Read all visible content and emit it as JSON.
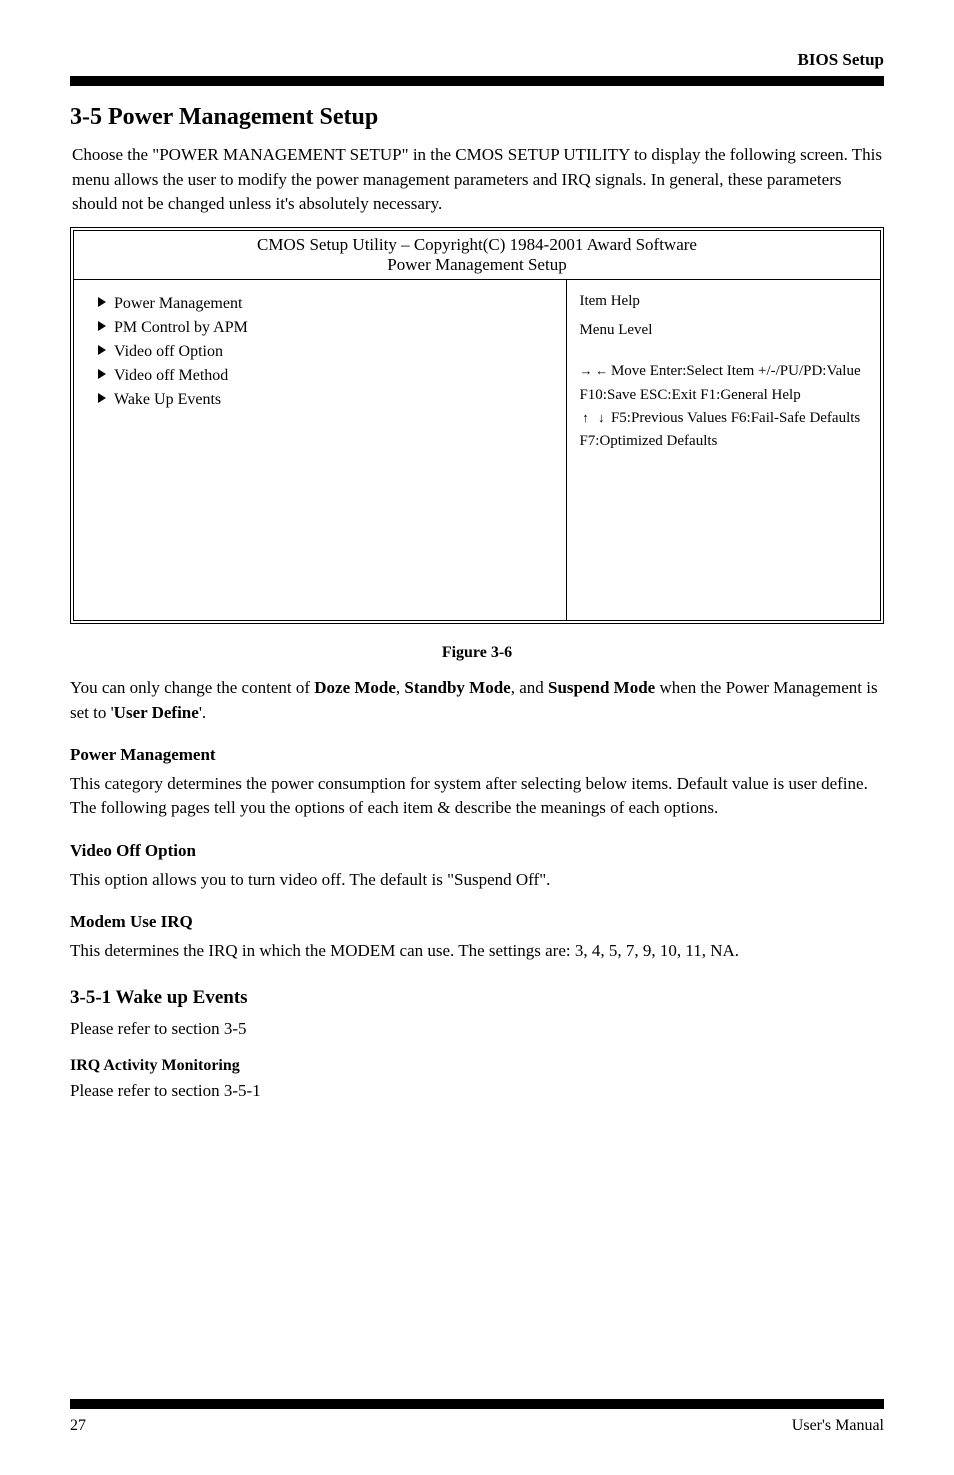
{
  "header": {
    "label": "BIOS Setup"
  },
  "section_title": "3-5  Power Management Setup",
  "intro": "Choose the \"POWER MANAGEMENT SETUP\" in the CMOS SETUP UTILITY to display the following screen. This menu allows the user to modify the power management parameters and IRQ signals.  In general, these parameters should not be changed unless it's absolutely necessary.",
  "bios": {
    "title": "CMOS Setup Utility – Copyright(C) 1984-2001 Award Software\nPower Management Setup",
    "menu": [
      "Power Management",
      "PM Control by APM",
      "Video off Option",
      "Video off Method",
      "Wake Up Events"
    ],
    "help": {
      "heading": "Item Help",
      "menu_level_label": "Menu Level",
      "menu_level_value": "",
      "lines": [
        "Move  Enter:Select  Item  +/-/PU/PD:Value  F10:Save ESC:Exit F1:General Help",
        "F5:Previous Values  F6:Fail-Safe Defaults  F7:Optimized Defaults"
      ]
    }
  },
  "figure_caption": "Figure 3-6",
  "body": {
    "p1": "You can only change the content of Doze Mode, Standby Mode, and Suspend Mode when the Power Management is set to 'User Define'.",
    "pm_heading": "Power Management",
    "pm_p1": "This category determines the power consumption for system after selecting below items. Default value is user define. The following pages tell you the options of each item & describe the meanings of each options.",
    "video_off_heading": "Video Off Option",
    "video_off_p": "This option allows you to turn video off. The default is \"Suspend Off\".",
    "mo_heading": "Modem Use IRQ",
    "mo_p": "This determines the IRQ in which the MODEM can use. The settings are: 3, 4, 5, 7, 9, 10, 11, NA.",
    "sub_title": "3-5-1  Wake up Events",
    "sub_p": "Please refer to section 3-5",
    "sub_sub": "IRQ Activity Monitoring",
    "sub_sub_p": "Please refer to section 3-5-1"
  },
  "footer": {
    "left": "27",
    "right": "User's Manual"
  }
}
